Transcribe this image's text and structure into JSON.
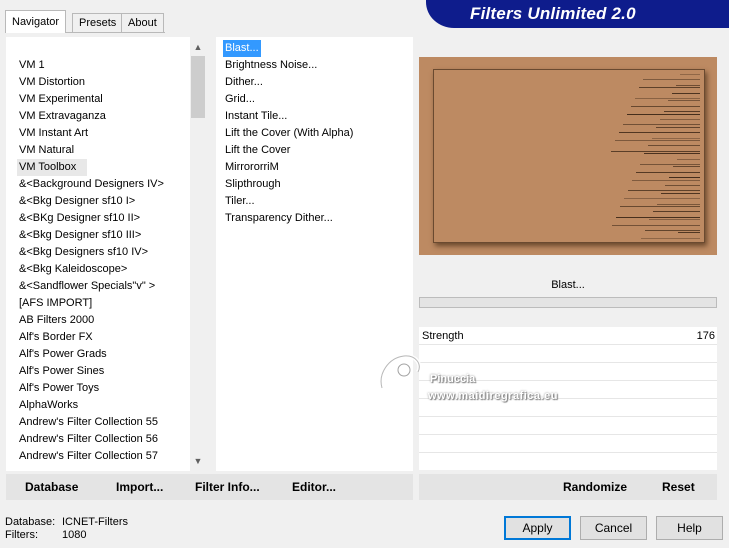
{
  "tabs": [
    "Navigator",
    "Presets",
    "About"
  ],
  "banner": {
    "title": "Filters Unlimited 2.0",
    "color": "#0e1c8c"
  },
  "categories": [
    "VM 1",
    "VM Distortion",
    "VM Experimental",
    "VM Extravaganza",
    "VM Instant Art",
    "VM Natural",
    "VM Toolbox",
    "&<Background Designers IV>",
    "&<Bkg Designer sf10 I>",
    "&<BKg Designer sf10 II>",
    "&<Bkg Designer sf10 III>",
    "&<Bkg Designers sf10 IV>",
    "&<Bkg Kaleidoscope>",
    "&<Sandflower Specials\"v\" >",
    "[AFS IMPORT]",
    "AB Filters 2000",
    "Alf's Border FX",
    "Alf's Power Grads",
    "Alf's Power Sines",
    "Alf's Power Toys",
    "AlphaWorks",
    "Andrew's Filter Collection 55",
    "Andrew's Filter Collection 56",
    "Andrew's Filter Collection 57"
  ],
  "selected_category": "VM Toolbox",
  "filters": [
    "Blast...",
    "Brightness Noise...",
    "Dither...",
    "Grid...",
    "Instant Tile...",
    "Lift the Cover (With Alpha)",
    "Lift the Cover",
    "MirrororriM",
    "Slipthrough",
    "Tiler...",
    "Transparency Dither..."
  ],
  "selected_filter": "Blast...",
  "preview": {
    "color": "#bd8a62"
  },
  "filter_title": "Blast...",
  "params": [
    {
      "name": "Strength",
      "value": "176"
    }
  ],
  "watermark": {
    "line1": "Pinuccia",
    "line2": "www.maidiregrafica.eu"
  },
  "left_buttons": {
    "database": "Database",
    "import": "Import...",
    "filter_info": "Filter Info...",
    "editor": "Editor..."
  },
  "right_buttons": {
    "randomize": "Randomize",
    "reset": "Reset"
  },
  "status": {
    "database_label": "Database:",
    "database_value": "ICNET-Filters",
    "filters_label": "Filters:",
    "filters_value": "1080"
  },
  "dialog_buttons": {
    "apply": "Apply",
    "cancel": "Cancel",
    "help": "Help"
  },
  "accent": "#3399ff"
}
